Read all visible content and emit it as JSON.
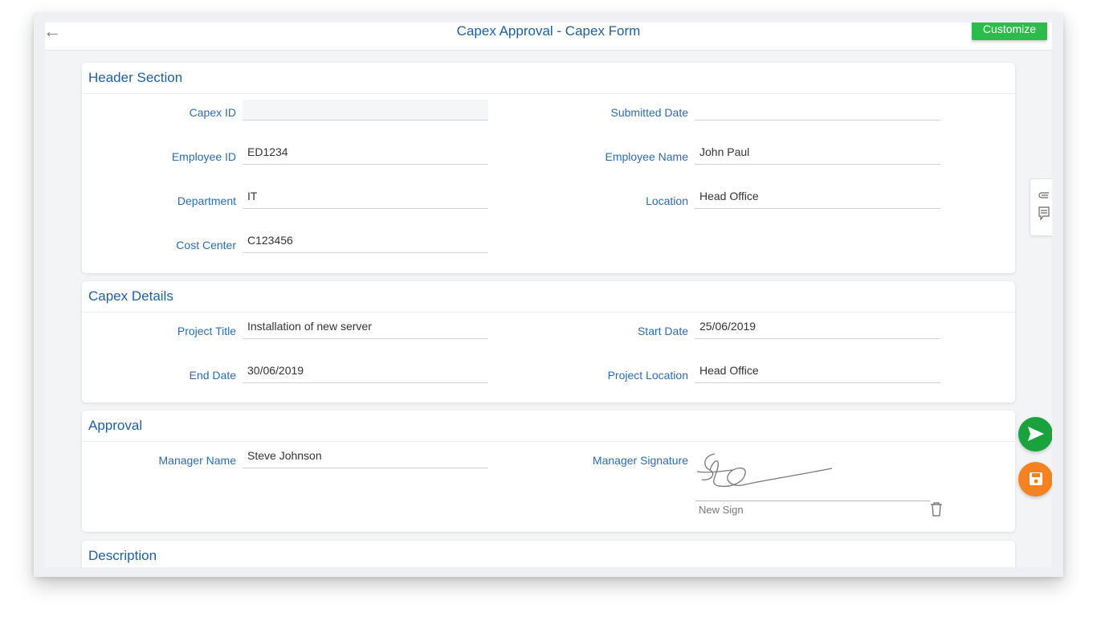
{
  "header": {
    "title": "Capex Approval - Capex Form",
    "customize_label": "Customize"
  },
  "sections": {
    "header_section": {
      "title": "Header Section",
      "capex_id": {
        "label": "Capex ID",
        "value": ""
      },
      "submitted_date": {
        "label": "Submitted Date",
        "value": ""
      },
      "employee_id": {
        "label": "Employee ID",
        "value": "ED1234"
      },
      "employee_name": {
        "label": "Employee Name",
        "value": "John Paul"
      },
      "department": {
        "label": "Department",
        "value": "IT"
      },
      "location": {
        "label": "Location",
        "value": "Head Office"
      },
      "cost_center": {
        "label": "Cost Center",
        "value": "C123456"
      }
    },
    "capex_details": {
      "title": "Capex Details",
      "project_title": {
        "label": "Project Title",
        "value": "Installation of new server"
      },
      "start_date": {
        "label": "Start Date",
        "value": "25/06/2019"
      },
      "end_date": {
        "label": "End Date",
        "value": "30/06/2019"
      },
      "project_location": {
        "label": "Project Location",
        "value": "Head Office"
      }
    },
    "approval": {
      "title": "Approval",
      "manager_name": {
        "label": "Manager Name",
        "value": "Steve Johnson"
      },
      "manager_signature": {
        "label": "Manager Signature",
        "new_sign_label": "New Sign"
      }
    },
    "description": {
      "title": "Description"
    }
  },
  "icons": {
    "back": "arrow-left",
    "side_tab": [
      "paperclip",
      "comment"
    ],
    "submit": "send",
    "save": "floppy-disk",
    "delete_signature": "trash"
  },
  "colors": {
    "accent_blue": "#1f5f9f",
    "customize_green": "#2dbb49",
    "submit_green": "#1aa33c",
    "save_orange": "#f58220"
  }
}
